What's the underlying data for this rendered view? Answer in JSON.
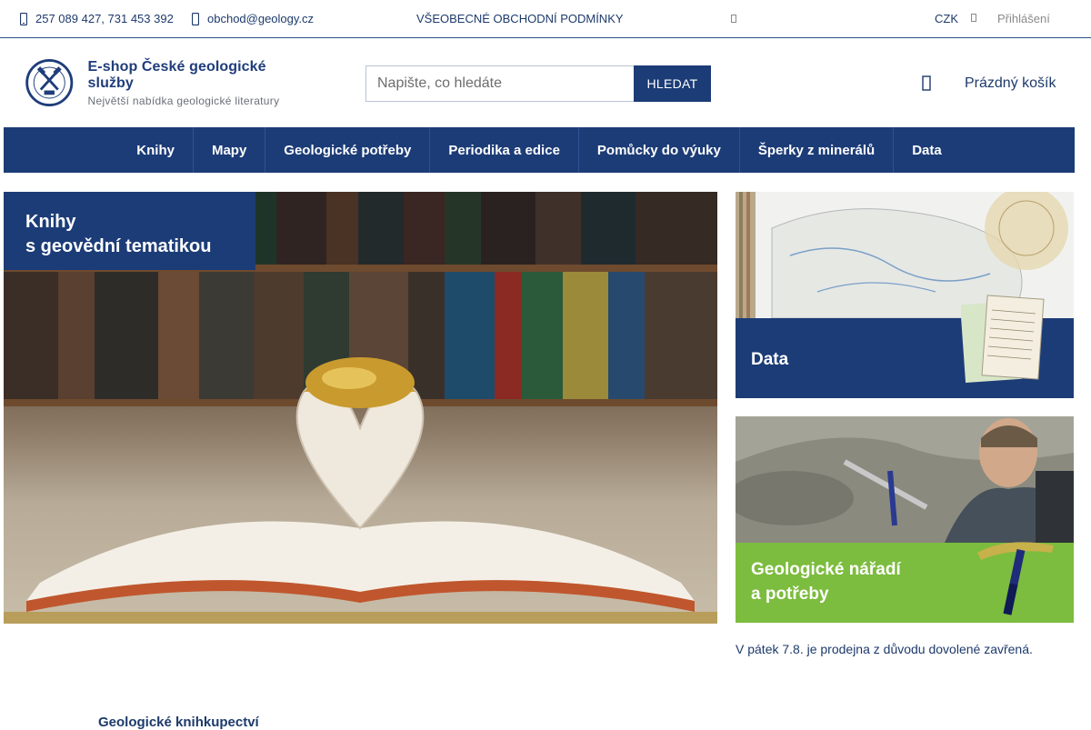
{
  "topbar": {
    "phone": "257 089 427, 731 453 392",
    "email": "obchod@geology.cz",
    "terms": "VŠEOBECNÉ OBCHODNÍ PODMÍNKY",
    "currency": "CZK",
    "login": "Přihlášení",
    "icons": [
      "phone-icon",
      "mail-icon",
      "info-icon",
      "chevron-down-icon"
    ]
  },
  "header": {
    "logo_title": "E-shop České geologické služby",
    "logo_subtitle": "Největší nabídka geologické literatury",
    "search_placeholder": "Napište, co hledáte",
    "search_button": "HLEDAT",
    "cart_label": "Prázdný košík"
  },
  "nav": {
    "items": [
      "Knihy",
      "Mapy",
      "Geologické potřeby",
      "Periodika a edice",
      "Pomůcky do výuky",
      "Šperky z minerálů",
      "Data"
    ]
  },
  "hero": {
    "tag_line1": "Knihy",
    "tag_line2": "s geovědní tematikou"
  },
  "banners": {
    "data_label": "Data",
    "tools_line1": "Geologické nářadí",
    "tools_line2": "a potřeby"
  },
  "notice": "V pátek 7.8. je prodejna z důvodu dovolené zavřená.",
  "footer_heading": "Geologické knihkupectví",
  "colors": {
    "brand_navy": "#1c3c77",
    "accent_green": "#7cbc3e"
  }
}
